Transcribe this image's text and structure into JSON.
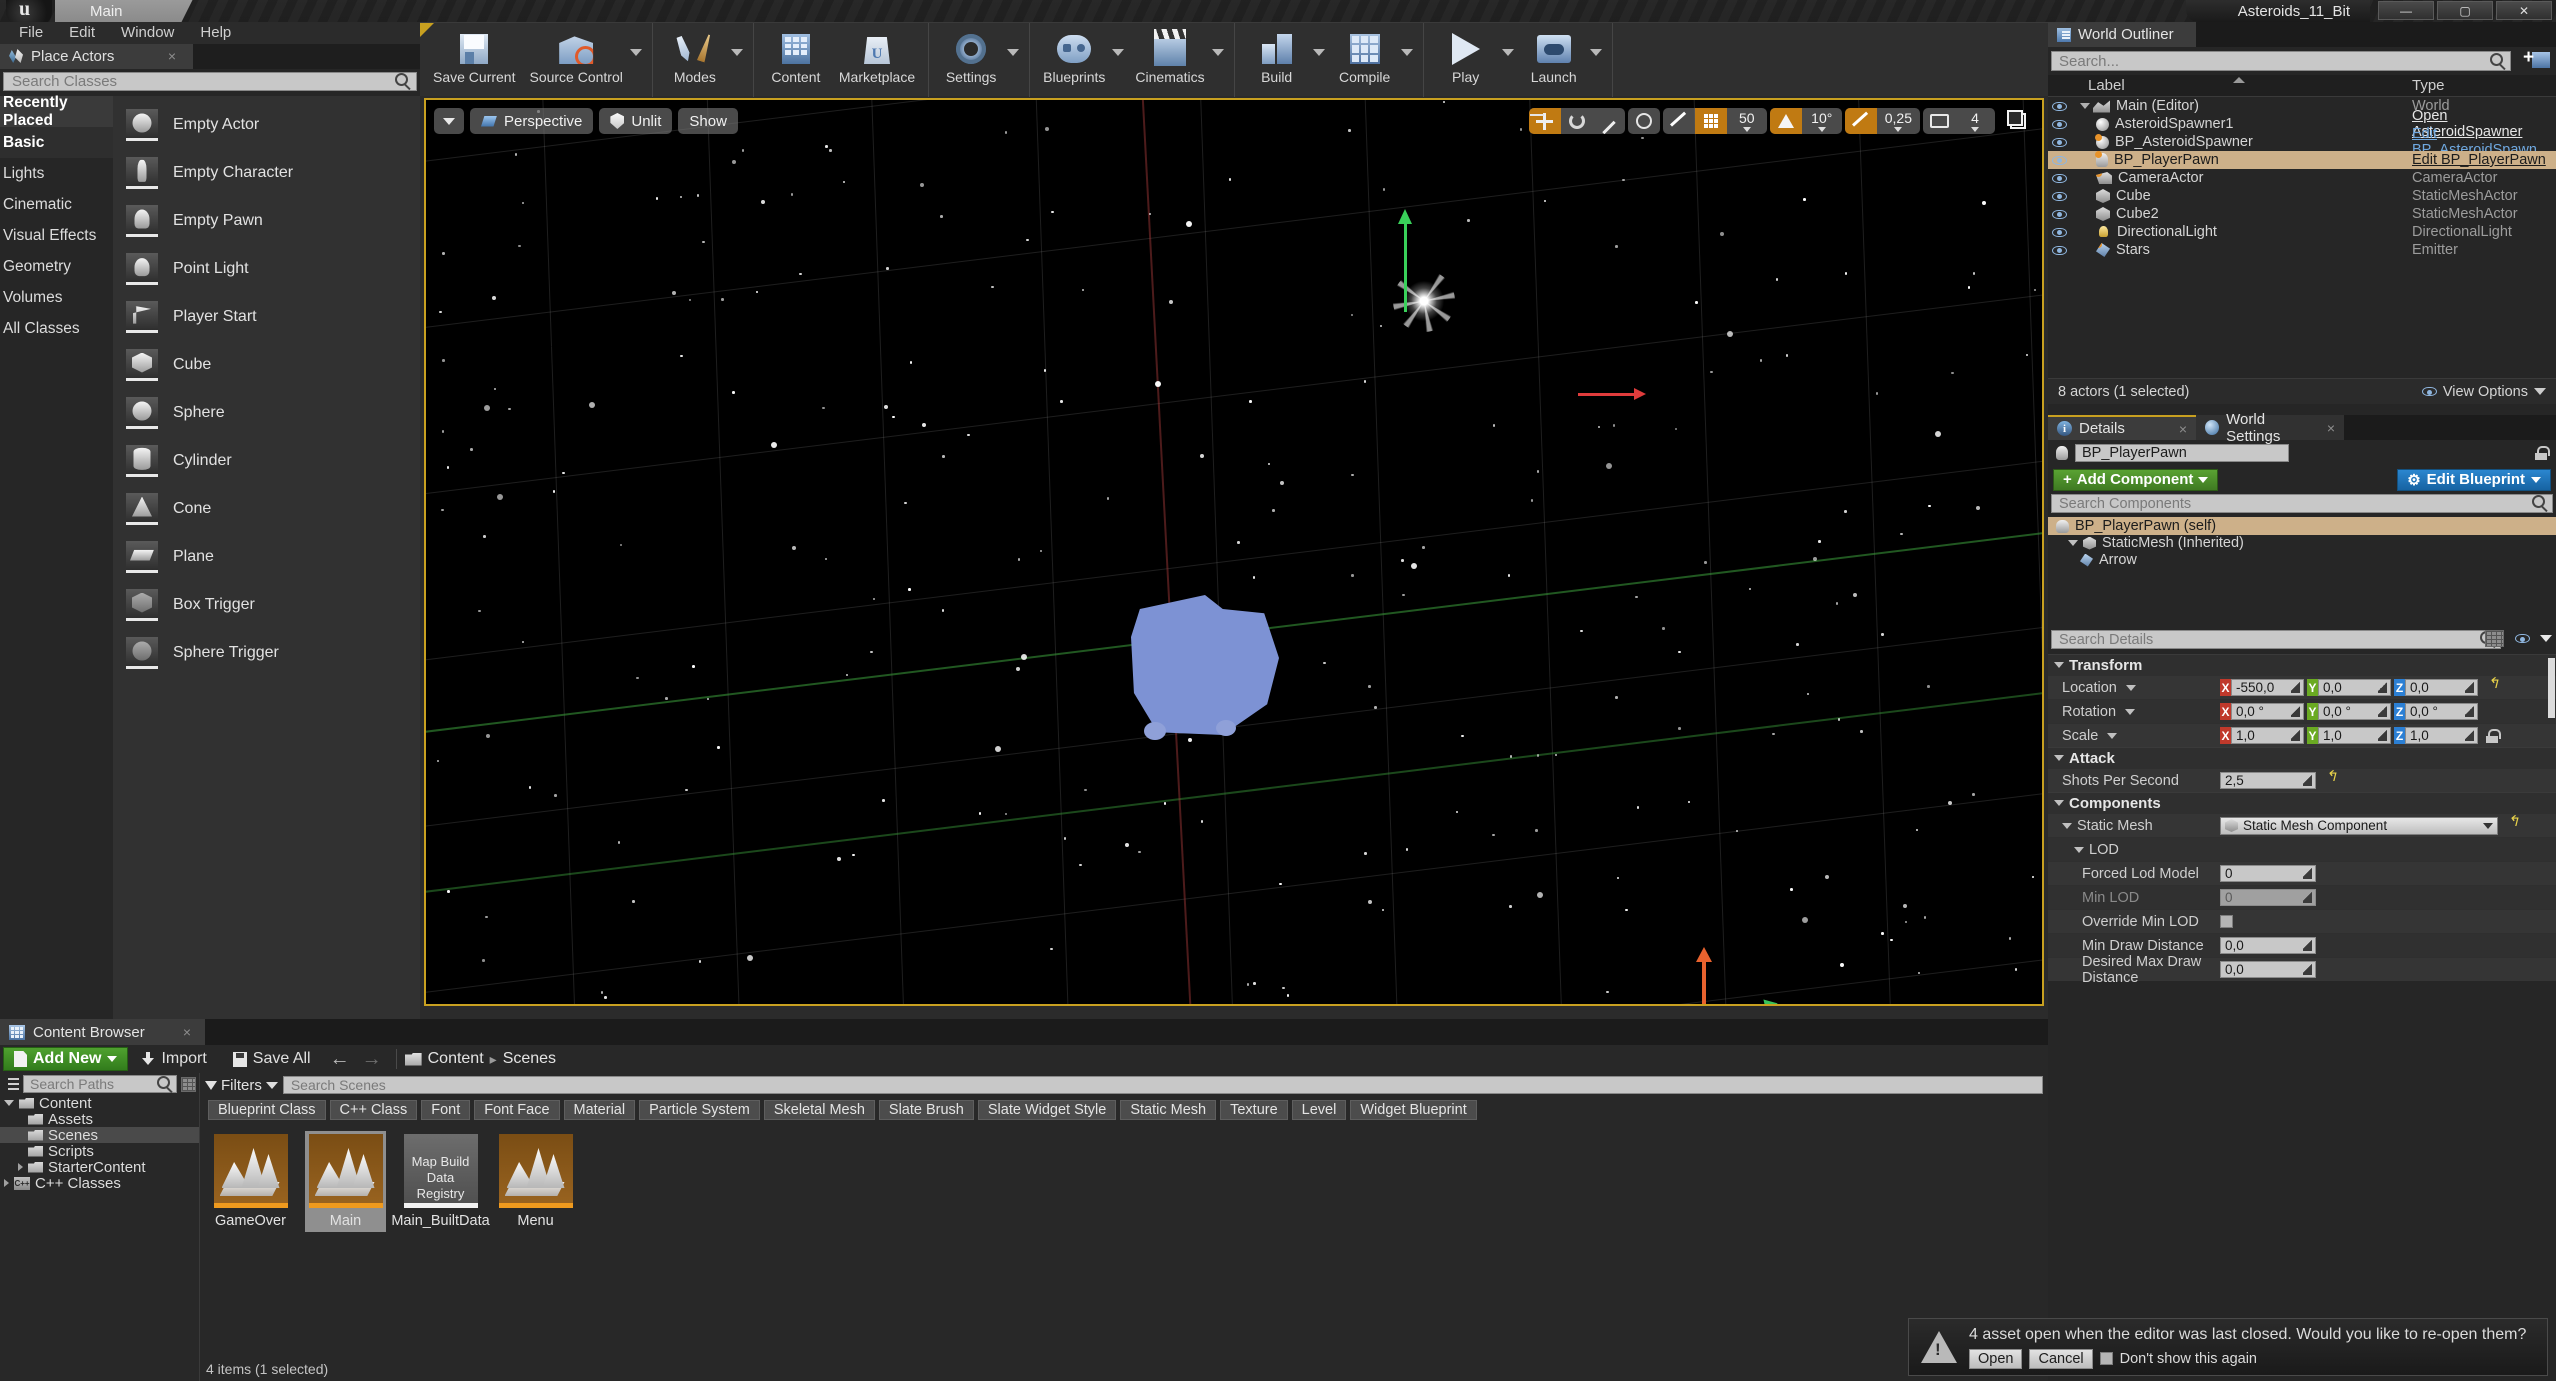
{
  "titlebar": {
    "project_tab": "Main",
    "right_title": "Asteroids_11_Bit",
    "min": "—",
    "max": "▢",
    "close": "✕"
  },
  "menubar": {
    "items": [
      "File",
      "Edit",
      "Window",
      "Help"
    ]
  },
  "place_actors": {
    "tab_label": "Place Actors",
    "tab_close": "×",
    "search_placeholder": "Search Classes",
    "categories": [
      {
        "label": "Recently Placed",
        "state": "sel"
      },
      {
        "label": "Basic",
        "state": "act"
      },
      {
        "label": "Lights",
        "state": ""
      },
      {
        "label": "Cinematic",
        "state": ""
      },
      {
        "label": "Visual Effects",
        "state": ""
      },
      {
        "label": "Geometry",
        "state": ""
      },
      {
        "label": "Volumes",
        "state": ""
      },
      {
        "label": "All Classes",
        "state": ""
      }
    ],
    "items": [
      {
        "label": "Empty Actor",
        "shape": "sh-sphere"
      },
      {
        "label": "Empty Character",
        "shape": "sh-char"
      },
      {
        "label": "Empty Pawn",
        "shape": "sh-pawn"
      },
      {
        "label": "Point Light",
        "shape": "sh-bulb"
      },
      {
        "label": "Player Start",
        "shape": "sh-flag"
      },
      {
        "label": "Cube",
        "shape": "sh-cube"
      },
      {
        "label": "Sphere",
        "shape": "sh-sphere"
      },
      {
        "label": "Cylinder",
        "shape": "sh-cyl"
      },
      {
        "label": "Cone",
        "shape": "sh-cone"
      },
      {
        "label": "Plane",
        "shape": "sh-plane"
      },
      {
        "label": "Box Trigger",
        "shape": "sh-box"
      },
      {
        "label": "Sphere Trigger",
        "shape": "sh-sphtr"
      }
    ]
  },
  "toolbar": {
    "groups": [
      {
        "buttons": [
          {
            "label": "Save Current",
            "glyph": "g-save",
            "caret": false
          },
          {
            "label": "Source Control",
            "glyph": "g-src",
            "caret": true
          }
        ]
      },
      {
        "buttons": [
          {
            "label": "Modes",
            "glyph": "g-modes",
            "caret": true
          }
        ]
      },
      {
        "buttons": [
          {
            "label": "Content",
            "glyph": "g-content",
            "caret": false
          },
          {
            "label": "Marketplace",
            "glyph": "g-mkt",
            "caret": false
          }
        ]
      },
      {
        "buttons": [
          {
            "label": "Settings",
            "glyph": "g-gear",
            "caret": true
          }
        ]
      },
      {
        "buttons": [
          {
            "label": "Blueprints",
            "glyph": "g-bp",
            "caret": true
          },
          {
            "label": "Cinematics",
            "glyph": "g-cine",
            "caret": true
          }
        ]
      },
      {
        "buttons": [
          {
            "label": "Build",
            "glyph": "g-build",
            "caret": true
          },
          {
            "label": "Compile",
            "glyph": "g-comp",
            "caret": true
          }
        ]
      },
      {
        "buttons": [
          {
            "label": "Play",
            "glyph": "g-play",
            "caret": true
          },
          {
            "label": "Launch",
            "glyph": "g-launch",
            "caret": true
          }
        ]
      }
    ]
  },
  "viewport": {
    "left_controls": {
      "menu_caret": "caret-down-icon",
      "perspective": "Perspective",
      "viewmode": "Unlit",
      "show": "Show"
    },
    "right_controls": {
      "transform_tools": [
        "translate-icon",
        "rotate-icon",
        "scale-icon"
      ],
      "coordinate_system": "world-icon",
      "surface_snap": "surface-snap-icon",
      "grid_snap_on": "grid-icon",
      "grid_snap_value": "50",
      "angle_snap_on": "angle-icon",
      "angle_snap_value": "10°",
      "scale_snap_on": "scale-snap-icon",
      "scale_snap_value": "0,25",
      "camera_speed_icon": "camera-speed-icon",
      "camera_speed_value": "4",
      "maximize": "maximize-viewport-icon"
    },
    "axis_labels": {
      "x": "x",
      "y": "y",
      "z": "z"
    }
  },
  "world_outliner": {
    "tab_label": "World Outliner",
    "tab_close": "×",
    "search_placeholder": "Search...",
    "columns": {
      "label": "Label",
      "type": "Type"
    },
    "rows": [
      {
        "label": "Main (Editor)",
        "type": "World",
        "type_style": "gray",
        "icon": "world",
        "indent": 0,
        "selected": false
      },
      {
        "label": "AsteroidSpawner1",
        "type": "Open AsteroidSpawner",
        "type_style": "link",
        "icon": "sphere",
        "indent": 1,
        "selected": false
      },
      {
        "label": "BP_AsteroidSpawner",
        "type": "Edit BP_AsteroidSpawn",
        "type_style": "blue",
        "icon": "sphere-bp",
        "indent": 1,
        "selected": false
      },
      {
        "label": "BP_PlayerPawn",
        "type": "Edit BP_PlayerPawn",
        "type_style": "dark",
        "icon": "pawn-bp",
        "indent": 1,
        "selected": true
      },
      {
        "label": "CameraActor",
        "type": "CameraActor",
        "type_style": "gray",
        "icon": "camera-bp",
        "indent": 1,
        "selected": false
      },
      {
        "label": "Cube",
        "type": "StaticMeshActor",
        "type_style": "gray",
        "icon": "mesh",
        "indent": 1,
        "selected": false
      },
      {
        "label": "Cube2",
        "type": "StaticMeshActor",
        "type_style": "gray",
        "icon": "mesh",
        "indent": 1,
        "selected": false
      },
      {
        "label": "DirectionalLight",
        "type": "DirectionalLight",
        "type_style": "gray",
        "icon": "light",
        "indent": 1,
        "selected": false
      },
      {
        "label": "Stars",
        "type": "Emitter",
        "type_style": "gray",
        "icon": "emitter-bp",
        "indent": 1,
        "selected": false
      }
    ],
    "footer_count": "8 actors (1 selected)",
    "view_options": "View Options"
  },
  "details": {
    "tabs": [
      {
        "label": "Details",
        "active": true,
        "close": "×"
      },
      {
        "label": "World Settings",
        "active": false,
        "close": "×"
      }
    ],
    "actor_name": "BP_PlayerPawn",
    "add_component": "Add Component",
    "edit_blueprint": "Edit Blueprint",
    "search_components_placeholder": "Search Components",
    "components": [
      {
        "label": "BP_PlayerPawn (self)",
        "selected": true,
        "indent": 0
      },
      {
        "label": "StaticMesh (Inherited)",
        "selected": false,
        "indent": 1
      },
      {
        "label": "Arrow",
        "selected": false,
        "indent": 2
      }
    ],
    "search_details_placeholder": "Search Details",
    "sections": [
      {
        "title": "Transform",
        "rows": [
          {
            "label": "Location",
            "type": "vector",
            "dropdown": true,
            "x": "-550,0",
            "y": "0,0",
            "z": "0,0",
            "revert": true
          },
          {
            "label": "Rotation",
            "type": "vector",
            "dropdown": true,
            "x": "0,0 °",
            "y": "0,0 °",
            "z": "0,0 °",
            "revert": false
          },
          {
            "label": "Scale",
            "type": "vector",
            "dropdown": true,
            "x": "1,0",
            "y": "1,0",
            "z": "1,0",
            "lock": true
          }
        ]
      },
      {
        "title": "Attack",
        "rows": [
          {
            "label": "Shots Per Second",
            "type": "number",
            "value": "2,5",
            "revert": true
          }
        ]
      },
      {
        "title": "Components",
        "rows": [
          {
            "label": "Static Mesh",
            "type": "combo",
            "value": "Static Mesh Component",
            "revert": true,
            "depth": 1,
            "collapse": true
          },
          {
            "label": "LOD",
            "type": "group",
            "depth": 2
          },
          {
            "label": "Forced Lod Model",
            "type": "number",
            "value": "0",
            "depth": 3
          },
          {
            "label": "Min LOD",
            "type": "number",
            "value": "0",
            "depth": 3,
            "disabled": true
          },
          {
            "label": "Override Min LOD",
            "type": "checkbox",
            "checked": false,
            "depth": 3
          },
          {
            "label": "Min Draw Distance",
            "type": "number",
            "value": "0,0",
            "depth": 3
          },
          {
            "label": "Desired Max Draw Distance",
            "type": "number",
            "value": "0,0",
            "depth": 3
          }
        ]
      }
    ]
  },
  "content_browser": {
    "tab_label": "Content Browser",
    "tab_close": "×",
    "add_new": "Add New",
    "import": "Import",
    "save_all": "Save All",
    "back": "←",
    "forward": "→",
    "breadcrumb": [
      "Content",
      "Scenes"
    ],
    "breadcrumb_sep": "▸",
    "search_paths_placeholder": "Search Paths",
    "tree": [
      {
        "label": "Content",
        "depth": 0,
        "expander": "down",
        "selected": false,
        "icon": "folder"
      },
      {
        "label": "Assets",
        "depth": 1,
        "expander": "",
        "selected": false,
        "icon": "folder"
      },
      {
        "label": "Scenes",
        "depth": 1,
        "expander": "",
        "selected": true,
        "icon": "folder"
      },
      {
        "label": "Scripts",
        "depth": 1,
        "expander": "",
        "selected": false,
        "icon": "folder"
      },
      {
        "label": "StarterContent",
        "depth": 1,
        "expander": "right",
        "selected": false,
        "icon": "folder"
      },
      {
        "label": "C++ Classes",
        "depth": 0,
        "expander": "right",
        "selected": false,
        "icon": "cpp"
      }
    ],
    "filters_label": "Filters",
    "search_assets_placeholder": "Search Scenes",
    "type_chips": [
      "Blueprint Class",
      "C++ Class",
      "Font",
      "Font Face",
      "Material",
      "Particle System",
      "Skeletal Mesh",
      "Slate Brush",
      "Slate Widget Style",
      "Static Mesh",
      "Texture",
      "Level",
      "Widget Blueprint"
    ],
    "assets": [
      {
        "label": "GameOver",
        "kind": "level",
        "selected": false
      },
      {
        "label": "Main",
        "kind": "level",
        "selected": true
      },
      {
        "label": "Main_BuiltData",
        "kind": "data",
        "caption": "Map Build Data Registry",
        "selected": false
      },
      {
        "label": "Menu",
        "kind": "level",
        "selected": false
      }
    ],
    "status": "4 items (1 selected)"
  },
  "notification": {
    "message": "4 asset  open when the editor was last closed. Would you like to re-open them?",
    "open": "Open",
    "cancel": "Cancel",
    "dont_show": "Don't show this again"
  },
  "colors": {
    "accent_yellow": "#c8a020",
    "selection_tan": "#cdb089",
    "green_button": "#4fa12f",
    "blue_button": "#2b86cf",
    "link_blue": "#6fa8e0",
    "asset_orange": "#ef9a1e"
  }
}
